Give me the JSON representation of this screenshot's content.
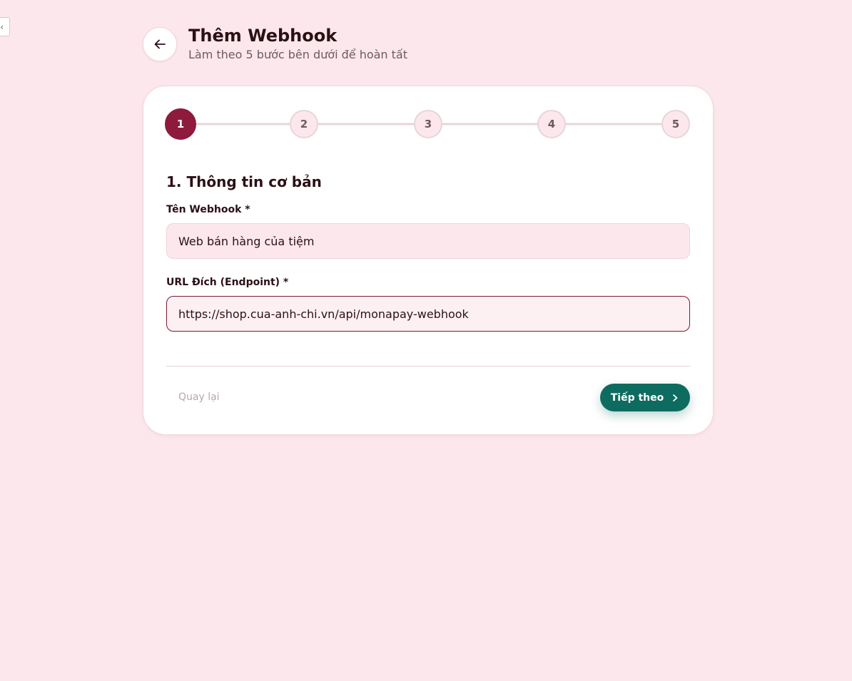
{
  "edge_tab": {
    "glyph": "‹"
  },
  "header": {
    "title": "Thêm Webhook",
    "subtitle": "Làm theo 5 bước bên dưới để hoàn tất"
  },
  "stepper": {
    "current_step": 1,
    "steps": [
      "1",
      "2",
      "3",
      "4",
      "5"
    ]
  },
  "form": {
    "section_title": "1. Thông tin cơ bản",
    "name_label": "Tên Webhook *",
    "name_value": "Web bán hàng của tiệm",
    "url_label": "URL Đích (Endpoint) *",
    "url_value": "https://shop.cua-anh-chi.vn/api/monapay-webhook"
  },
  "footer": {
    "back_label": "Quay lại",
    "next_label": "Tiếp theo"
  },
  "colors": {
    "background": "#fce8ec",
    "primary": "#8e1b3c",
    "accent": "#0e6b5f"
  }
}
